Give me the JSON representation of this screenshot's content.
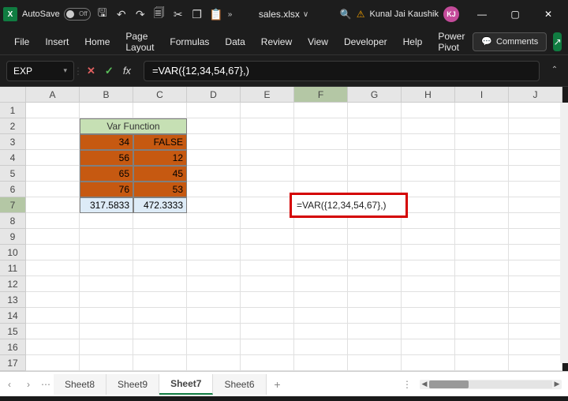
{
  "titlebar": {
    "app_icon_letter": "X",
    "autosave_label": "AutoSave",
    "toggle_off": "Off",
    "filename": "sales.xlsx",
    "filename_caret": "∨",
    "user_name": "Kunal Jai Kaushik",
    "avatar_initials": "KJ",
    "min": "—",
    "max": "▢",
    "close": "✕"
  },
  "qat": {
    "save": "🖫",
    "undo": "↶",
    "redo": "↷",
    "print": "🗐",
    "cut": "✂",
    "copy": "❐",
    "paste": "📋",
    "more": "»"
  },
  "ribbon": {
    "tabs": [
      "File",
      "Insert",
      "Home",
      "Page Layout",
      "Formulas",
      "Data",
      "Review",
      "View",
      "Developer",
      "Help",
      "Power Pivot"
    ],
    "comments": "Comments",
    "share_icon": "↗"
  },
  "formula": {
    "namebox": "EXP",
    "cancel": "✕",
    "ok": "✓",
    "fx": "fx",
    "bar": "=VAR({12,34,54,67},)"
  },
  "grid": {
    "cols": [
      "A",
      "B",
      "C",
      "D",
      "E",
      "F",
      "G",
      "H",
      "I",
      "J"
    ],
    "rows": [
      "1",
      "2",
      "3",
      "4",
      "5",
      "6",
      "7",
      "8",
      "9",
      "10",
      "11",
      "12",
      "13",
      "14",
      "15",
      "16",
      "17"
    ],
    "active_col": "F",
    "active_row": "7",
    "title_cell": "Var Function",
    "b3": "34",
    "c3": "FALSE",
    "b4": "56",
    "c4": "12",
    "b5": "65",
    "c5": "45",
    "b6": "76",
    "c6": "53",
    "b7": "317.5833",
    "c7": "472.3333",
    "f7_display": "=VAR({12,34,54,67},)"
  },
  "sheettabs": {
    "prev": "‹",
    "next": "›",
    "dots": "⋯",
    "tabs": [
      "Sheet8",
      "Sheet9",
      "Sheet7",
      "Sheet6"
    ],
    "active": "Sheet7",
    "add": "+",
    "vdots": "⋮",
    "ar_l": "◀",
    "ar_r": "▶"
  }
}
